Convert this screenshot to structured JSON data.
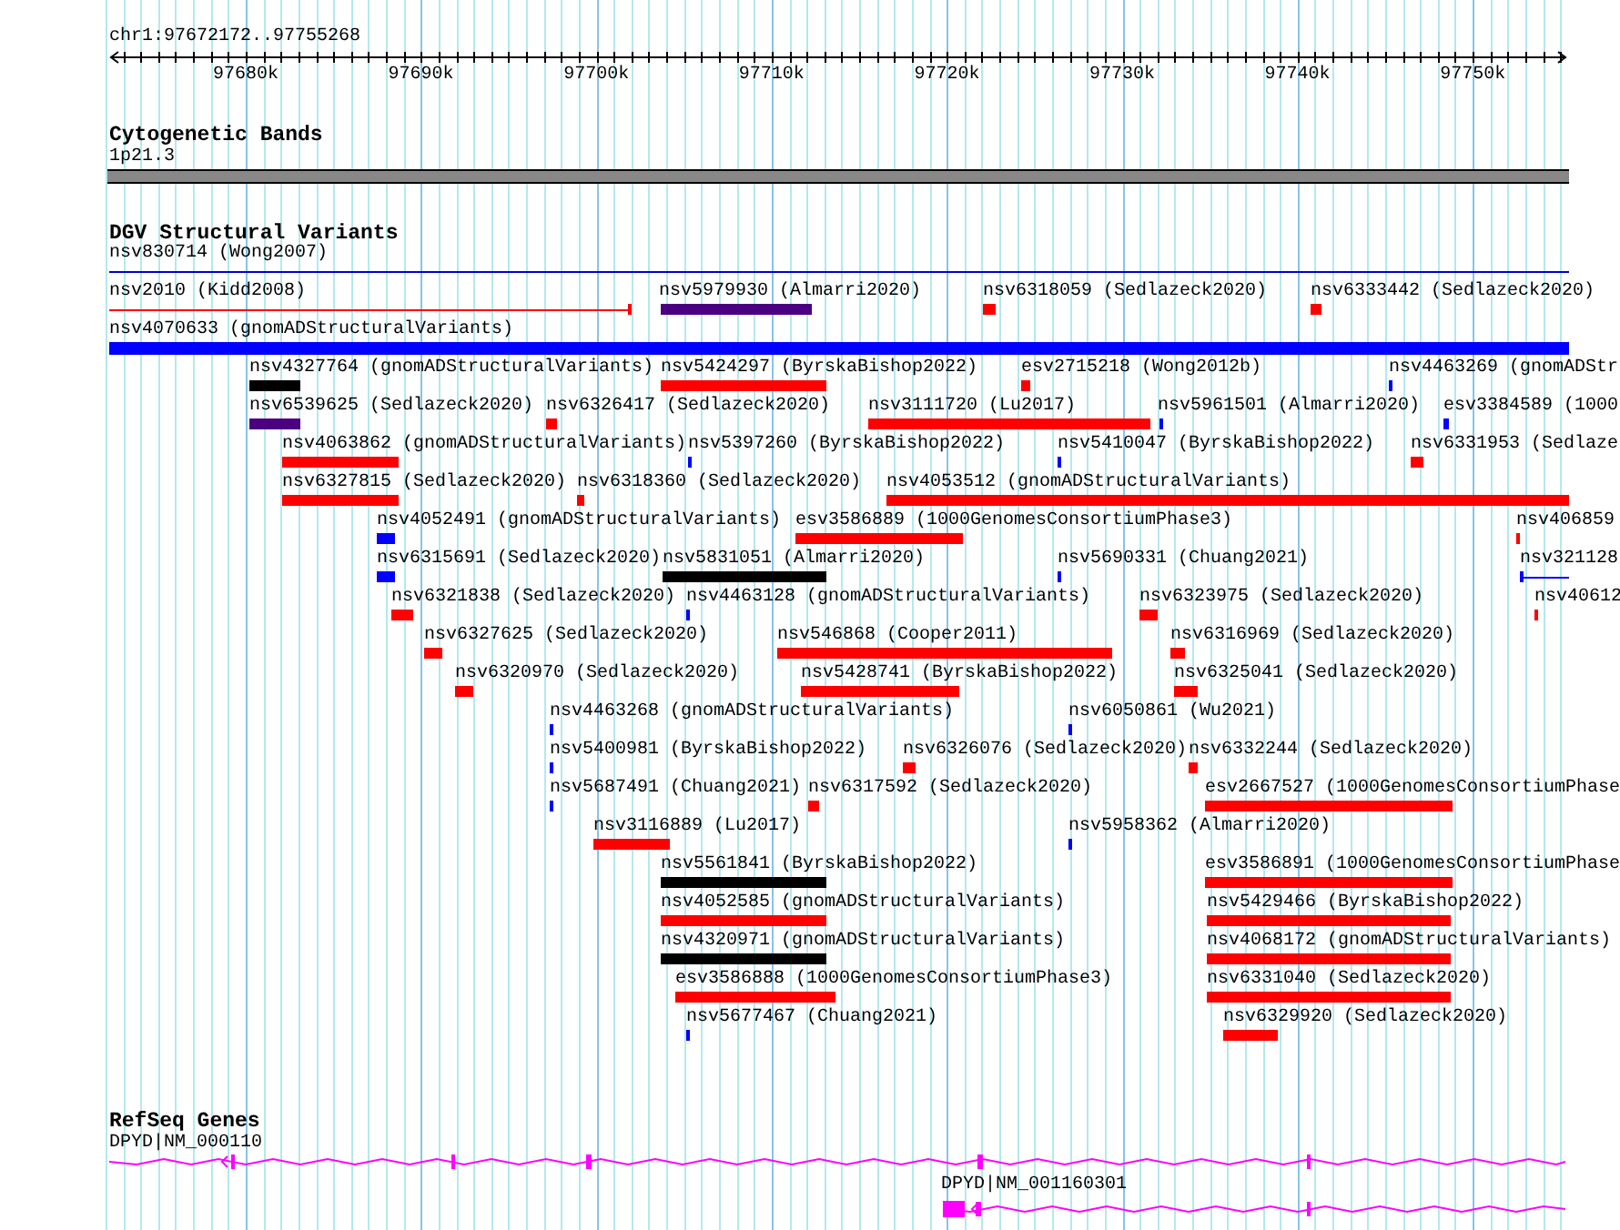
{
  "ruler": {
    "position": "chr1:97672172..97755268",
    "ticks": [
      "97680k",
      "97690k",
      "97700k",
      "97710k",
      "97720k",
      "97730k",
      "97740k",
      "97750k"
    ]
  },
  "cytogenetic_bands": {
    "title": "Cytogenetic Bands",
    "band": "1p21.3"
  },
  "dgv_structural_variants": {
    "title": "DGV Structural Variants",
    "rows": [
      {
        "features": [
          {
            "label": "nsv830714 (Wong2007)",
            "kind": "line",
            "color": "#0000cc"
          }
        ]
      },
      {
        "features": [
          {
            "label": "nsv2010 (Kidd2008)",
            "kind": "line",
            "color": "#ff0000"
          },
          {
            "label": "nsv5979930 (Almarri2020)",
            "kind": "bar",
            "color": "#4b0082"
          },
          {
            "label": "nsv6318059 (Sedlazeck2020)",
            "kind": "bar",
            "color": "#ff0000"
          },
          {
            "label": "nsv6333442 (Sedlazeck2020)",
            "kind": "bar",
            "color": "#ff0000"
          }
        ]
      },
      {
        "features": [
          {
            "label": "nsv4070633 (gnomADStructuralVariants)",
            "kind": "bar",
            "color": "#0000ff"
          }
        ]
      },
      {
        "features": [
          {
            "label": "nsv4327764 (gnomADStructuralVariants)",
            "kind": "bar",
            "color": "#000000"
          },
          {
            "label": "nsv5424297 (ByrskaBishop2022)",
            "kind": "bar",
            "color": "#ff0000"
          },
          {
            "label": "esv2715218 (Wong2012b)",
            "kind": "bar",
            "color": "#ff0000"
          },
          {
            "label": "nsv4463269 (gnomADStr",
            "kind": "bar",
            "color": "#0000ff"
          }
        ]
      },
      {
        "features": [
          {
            "label": "nsv6539625 (Sedlazeck2020)",
            "kind": "bar",
            "color": "#4b0082"
          },
          {
            "label": "nsv6326417 (Sedlazeck2020)",
            "kind": "bar",
            "color": "#ff0000"
          },
          {
            "label": "nsv3111720 (Lu2017)",
            "kind": "bar",
            "color": "#ff0000"
          },
          {
            "label": "nsv5961501 (Almarri2020)",
            "kind": "bar",
            "color": "#0000ff"
          },
          {
            "label": "esv3384589 (1000",
            "kind": "bar",
            "color": "#0000ff"
          }
        ]
      },
      {
        "features": [
          {
            "label": "nsv4063862 (gnomADStructuralVariants)",
            "kind": "bar",
            "color": "#ff0000"
          },
          {
            "label": "nsv5397260 (ByrskaBishop2022)",
            "kind": "bar",
            "color": "#0000ff"
          },
          {
            "label": "nsv5410047 (ByrskaBishop2022)",
            "kind": "bar",
            "color": "#0000ff"
          },
          {
            "label": "nsv6331953 (Sedlaze",
            "kind": "bar",
            "color": "#ff0000"
          }
        ]
      },
      {
        "features": [
          {
            "label": "nsv6327815 (Sedlazeck2020)",
            "kind": "bar",
            "color": "#ff0000"
          },
          {
            "label": "nsv6318360 (Sedlazeck2020)",
            "kind": "bar",
            "color": "#ff0000"
          },
          {
            "label": "nsv4053512 (gnomADStructuralVariants)",
            "kind": "bar",
            "color": "#ff0000"
          }
        ]
      },
      {
        "features": [
          {
            "label": "nsv4052491 (gnomADStructuralVariants)",
            "kind": "bar",
            "color": "#0000ff"
          },
          {
            "label": "esv3586889 (1000GenomesConsortiumPhase3)",
            "kind": "bar",
            "color": "#ff0000"
          },
          {
            "label": "nsv406859",
            "kind": "bar",
            "color": "#ff0000"
          }
        ]
      },
      {
        "features": [
          {
            "label": "nsv6315691 (Sedlazeck2020)",
            "kind": "bar",
            "color": "#0000ff"
          },
          {
            "label": "nsv5831051 (Almarri2020)",
            "kind": "bar",
            "color": "#000000"
          },
          {
            "label": "nsv5690331 (Chuang2021)",
            "kind": "bar",
            "color": "#0000ff"
          },
          {
            "label": "nsv321128",
            "kind": "line",
            "color": "#0000ff"
          }
        ]
      },
      {
        "features": [
          {
            "label": "nsv6321838 (Sedlazeck2020)",
            "kind": "bar",
            "color": "#ff0000"
          },
          {
            "label": "nsv4463128 (gnomADStructuralVariants)",
            "kind": "bar",
            "color": "#0000ff"
          },
          {
            "label": "nsv6323975 (Sedlazeck2020)",
            "kind": "bar",
            "color": "#ff0000"
          },
          {
            "label": "nsv40612",
            "kind": "bar",
            "color": "#ff0000"
          }
        ]
      },
      {
        "features": [
          {
            "label": "nsv6327625 (Sedlazeck2020)",
            "kind": "bar",
            "color": "#ff0000"
          },
          {
            "label": "nsv546868 (Cooper2011)",
            "kind": "bar",
            "color": "#ff0000"
          },
          {
            "label": "nsv6316969 (Sedlazeck2020)",
            "kind": "bar",
            "color": "#ff0000"
          }
        ]
      },
      {
        "features": [
          {
            "label": "nsv6320970 (Sedlazeck2020)",
            "kind": "bar",
            "color": "#ff0000"
          },
          {
            "label": "nsv5428741 (ByrskaBishop2022)",
            "kind": "bar",
            "color": "#ff0000"
          },
          {
            "label": "nsv6325041 (Sedlazeck2020)",
            "kind": "bar",
            "color": "#ff0000"
          }
        ]
      },
      {
        "features": [
          {
            "label": "nsv4463268 (gnomADStructuralVariants)",
            "kind": "bar",
            "color": "#0000ff"
          },
          {
            "label": "nsv6050861 (Wu2021)",
            "kind": "bar",
            "color": "#0000ff"
          }
        ]
      },
      {
        "features": [
          {
            "label": "nsv5400981 (ByrskaBishop2022)",
            "kind": "bar",
            "color": "#0000ff"
          },
          {
            "label": "nsv6326076 (Sedlazeck2020)",
            "kind": "bar",
            "color": "#ff0000"
          },
          {
            "label": "nsv6332244 (Sedlazeck2020)",
            "kind": "bar",
            "color": "#ff0000"
          }
        ]
      },
      {
        "features": [
          {
            "label": "nsv5687491 (Chuang2021)",
            "kind": "bar",
            "color": "#0000ff"
          },
          {
            "label": "nsv6317592 (Sedlazeck2020)",
            "kind": "bar",
            "color": "#ff0000"
          },
          {
            "label": "esv2667527 (1000GenomesConsortiumPhase",
            "kind": "bar",
            "color": "#ff0000"
          }
        ]
      },
      {
        "features": [
          {
            "label": "nsv3116889 (Lu2017)",
            "kind": "bar",
            "color": "#ff0000"
          },
          {
            "label": "nsv5958362 (Almarri2020)",
            "kind": "bar",
            "color": "#0000ff"
          }
        ]
      },
      {
        "features": [
          {
            "label": "nsv5561841 (ByrskaBishop2022)",
            "kind": "bar",
            "color": "#000000"
          },
          {
            "label": "esv3586891 (1000GenomesConsortiumPhase",
            "kind": "bar",
            "color": "#ff0000"
          }
        ]
      },
      {
        "features": [
          {
            "label": "nsv4052585 (gnomADStructuralVariants)",
            "kind": "bar",
            "color": "#ff0000"
          },
          {
            "label": "nsv5429466 (ByrskaBishop2022)",
            "kind": "bar",
            "color": "#ff0000"
          }
        ]
      },
      {
        "features": [
          {
            "label": "nsv4320971 (gnomADStructuralVariants)",
            "kind": "bar",
            "color": "#000000"
          },
          {
            "label": "nsv4068172 (gnomADStructuralVariants)",
            "kind": "bar",
            "color": "#ff0000"
          }
        ]
      },
      {
        "features": [
          {
            "label": "esv3586888 (1000GenomesConsortiumPhase3)",
            "kind": "bar",
            "color": "#ff0000"
          },
          {
            "label": "nsv6331040 (Sedlazeck2020)",
            "kind": "bar",
            "color": "#ff0000"
          }
        ]
      },
      {
        "features": [
          {
            "label": "nsv5677467 (Chuang2021)",
            "kind": "bar",
            "color": "#0000ff"
          },
          {
            "label": "nsv6329920 (Sedlazeck2020)",
            "kind": "bar",
            "color": "#ff0000"
          }
        ]
      }
    ]
  },
  "refseq_genes": {
    "title": "RefSeq Genes",
    "transcripts": [
      {
        "label": "DPYD|NM_000110"
      },
      {
        "label": "DPYD|NM_001160301"
      }
    ]
  }
}
